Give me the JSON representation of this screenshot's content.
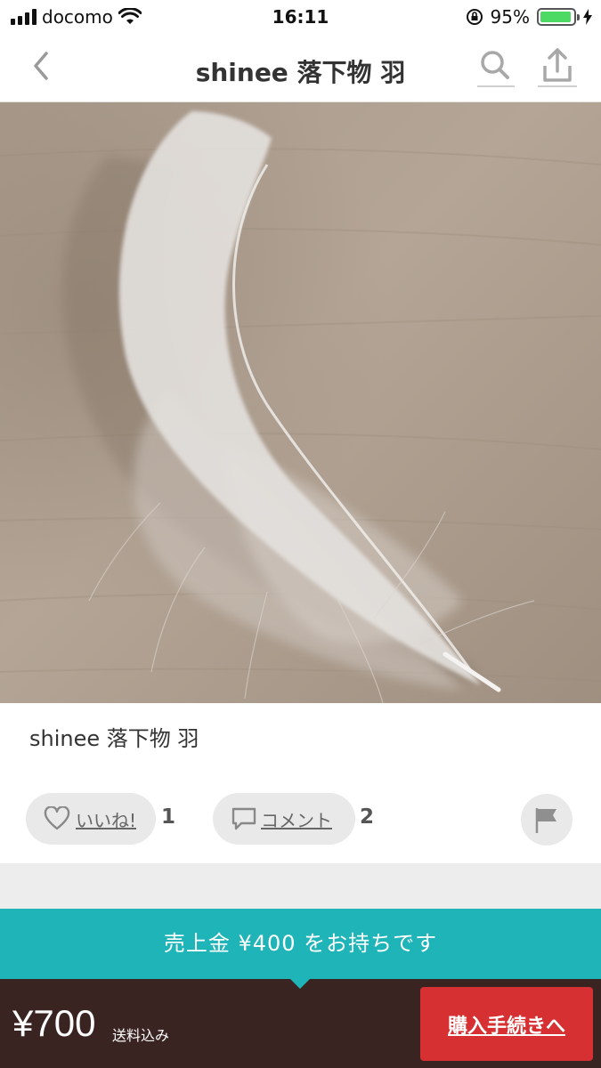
{
  "status_bar": {
    "carrier": "docomo",
    "time": "16:11",
    "battery_percent": "95%",
    "battery_level": 0.95,
    "battery_color": "#4cd964"
  },
  "nav": {
    "title": "shinee 落下物 羽",
    "back_icon": "chevron-left-icon",
    "search_icon": "search-icon",
    "share_icon": "share-icon"
  },
  "item": {
    "title": "shinee 落下物 羽",
    "photo_subject": "white feather on wooden surface"
  },
  "actions": {
    "like_label": "いいね!",
    "like_count": "1",
    "comment_label": "コメント",
    "comment_count": "2",
    "flag_icon": "flag-icon"
  },
  "balance": {
    "text": "売上金 ¥400 をお持ちです",
    "color": "#1fb4b8"
  },
  "purchase": {
    "price": "¥700",
    "shipping_note": "送料込み",
    "buy_label": "購入手続きへ",
    "buy_color": "#d73033",
    "bar_color": "#3a2422"
  }
}
